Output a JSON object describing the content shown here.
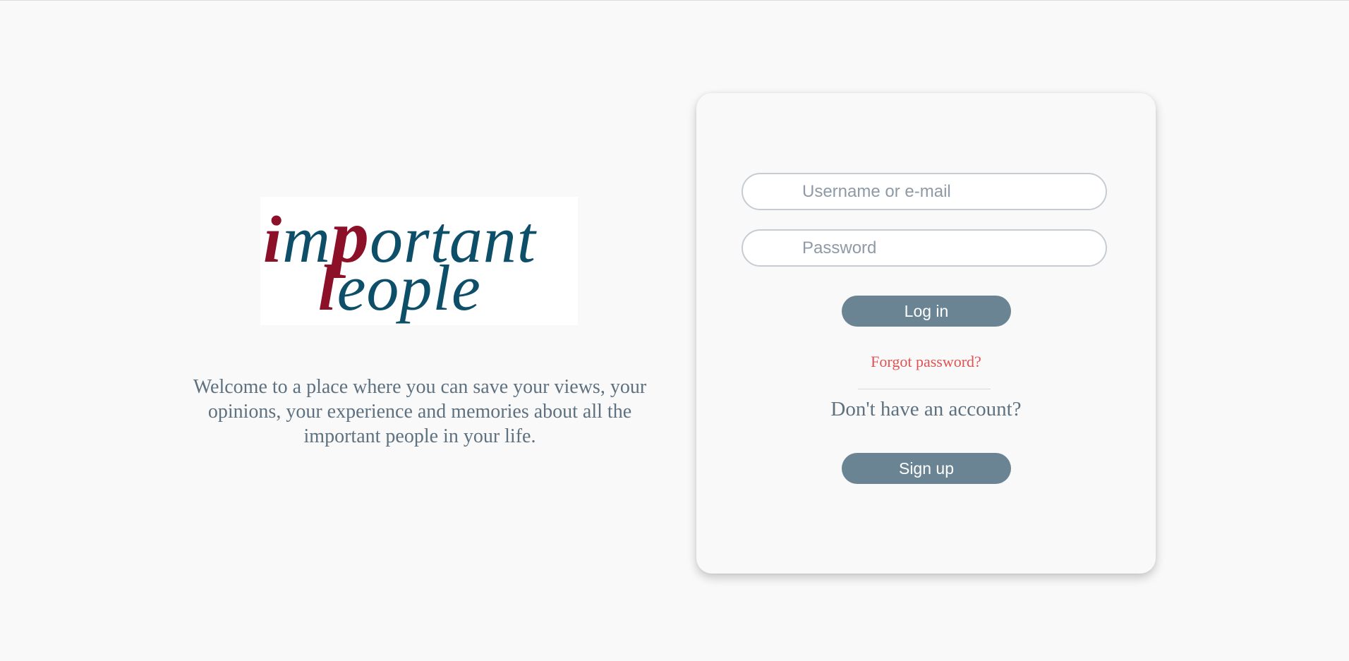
{
  "logo": {
    "line1": "important",
    "line2": "People",
    "colors": {
      "accent": "#8c1028",
      "primary": "#0d4f69"
    }
  },
  "welcome_text": "Welcome to a place where you can save your views, your opinions, your experience and memories about all the important people in your life.",
  "login_form": {
    "username_placeholder": "Username or e-mail",
    "password_placeholder": "Password",
    "login_label": "Log in",
    "forgot_label": "Forgot password?",
    "no_account_text": "Don't have an account?",
    "signup_label": "Sign up"
  },
  "colors": {
    "button": "#6a8494",
    "forgot_link": "#e05252",
    "text": "#5e7180",
    "background": "#f9f9f9"
  }
}
